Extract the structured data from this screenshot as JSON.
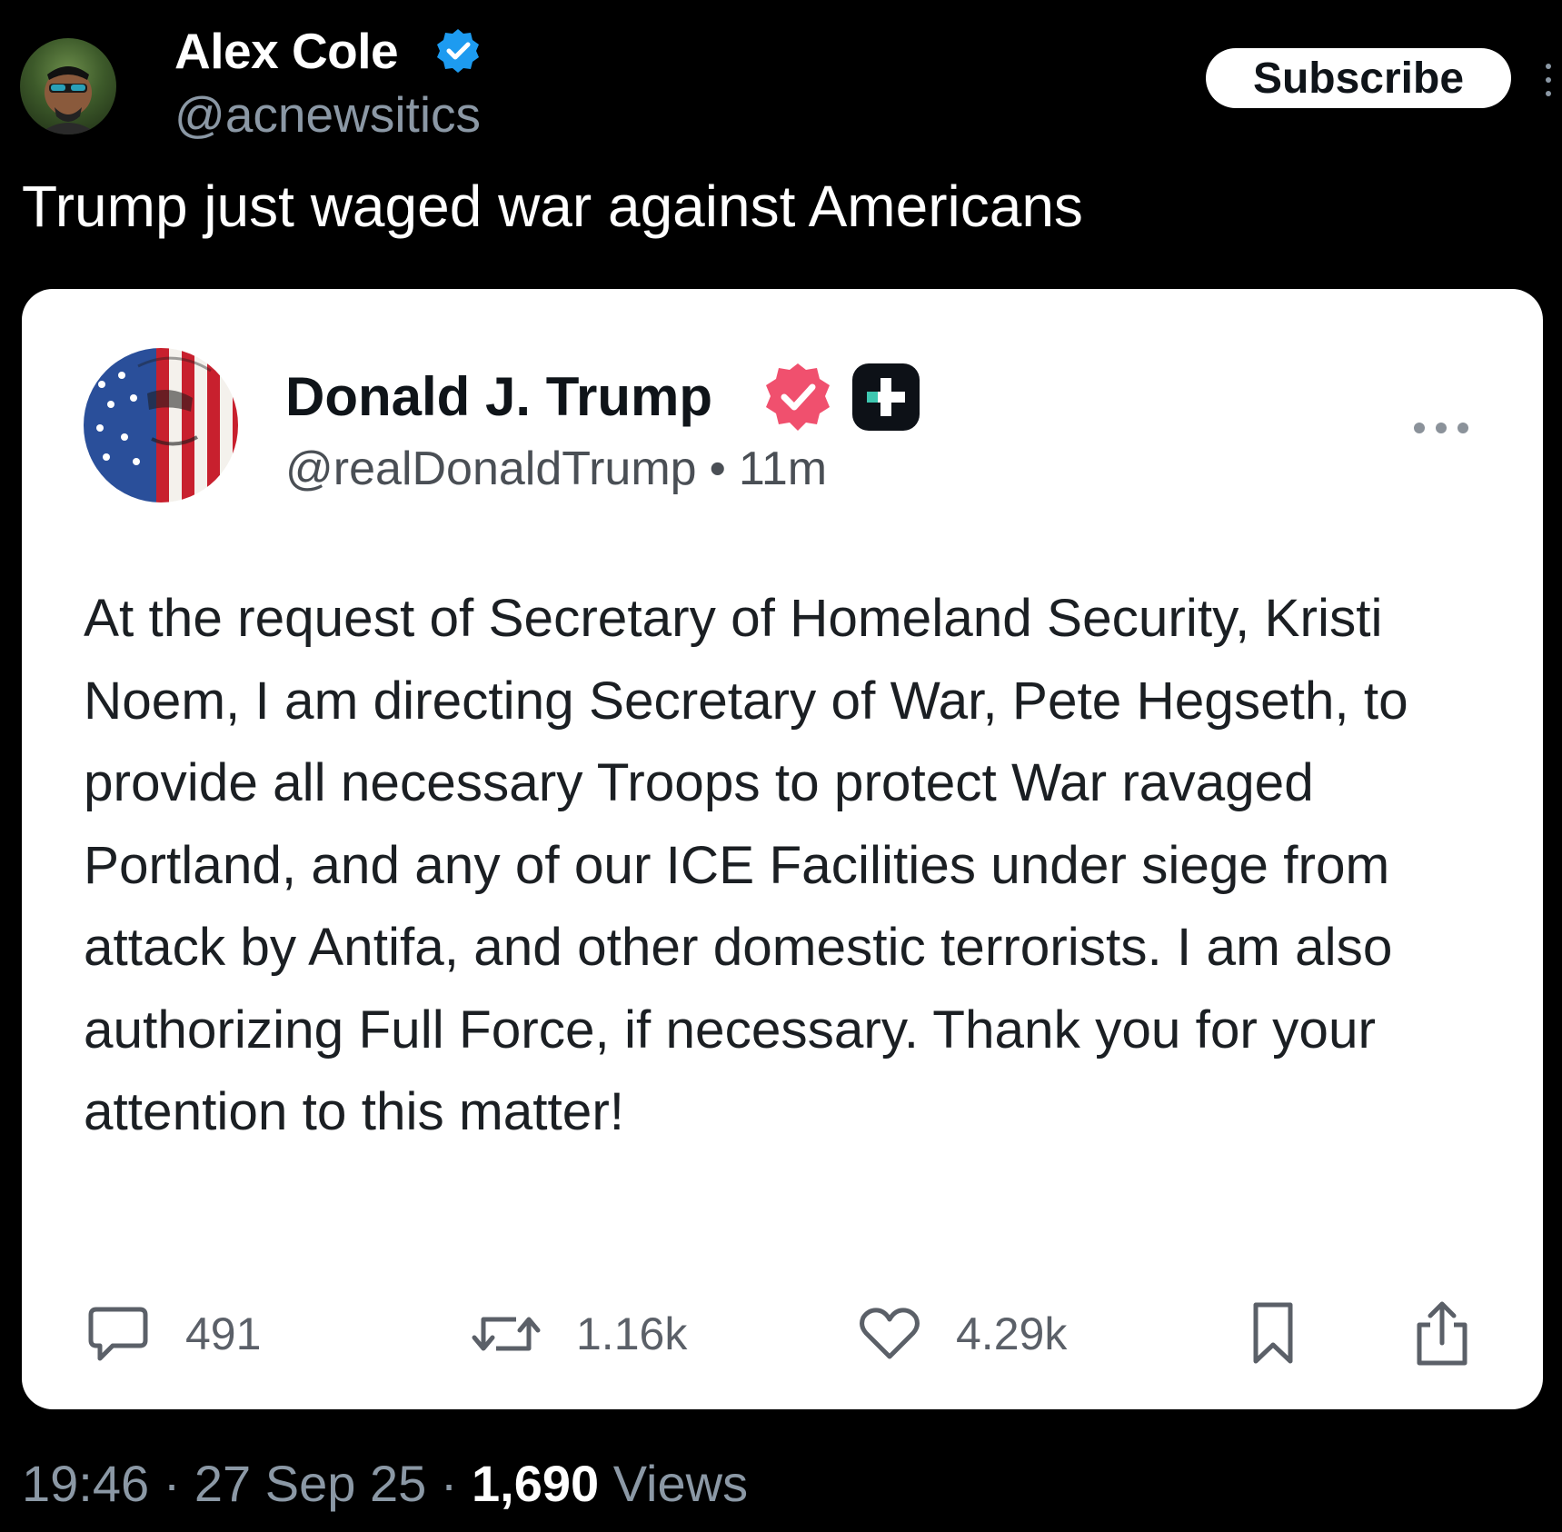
{
  "author": {
    "name": "Alex Cole",
    "handle": "@acnewsitics",
    "verified": true
  },
  "subscribe_label": "Subscribe",
  "post_text": "Trump just waged war against Americans",
  "quoted_post": {
    "name": "Donald J. Trump",
    "handle": "@realDonaldTrump",
    "separator": "•",
    "time": "11m",
    "body": "At the request of Secretary of Homeland Security, Kristi Noem, I am directing Secretary of War, Pete Hegseth, to provide all necessary Troops to protect War ravaged Portland, and any of our ICE Facilities under siege from attack by Antifa, and other domestic terrorists. I am also authorizing Full Force, if necessary. Thank you for your attention to this matter!",
    "replies": "491",
    "reposts": "1.16k",
    "likes": "4.29k"
  },
  "footer": {
    "time": "19:46",
    "sep1": " · ",
    "date": "27 Sep 25",
    "sep2": " · ",
    "views_count": "1,690",
    "views_label": " Views"
  },
  "colors": {
    "background": "#000000",
    "card": "#ffffff",
    "verified_blue": "#1d9bf0",
    "verified_red": "#f0506e",
    "muted_text": "#8b98a5"
  },
  "icons": [
    "verified-badge-icon",
    "more-vertical-icon",
    "plus-badge-icon",
    "more-horizontal-icon",
    "comment-icon",
    "repost-icon",
    "heart-icon",
    "bookmark-icon",
    "share-icon"
  ]
}
